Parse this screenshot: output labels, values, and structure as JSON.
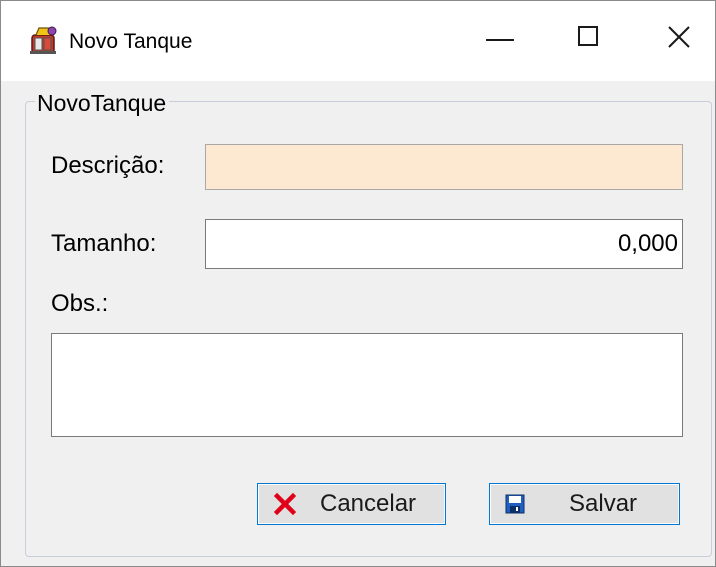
{
  "window": {
    "title": "Novo Tanque",
    "app_icon": "tank-app-icon",
    "controls": {
      "minimize_icon": "minimize-icon",
      "maximize_icon": "maximize-icon",
      "close_icon": "close-icon"
    }
  },
  "form": {
    "group_title": "NovoTanque",
    "descricao": {
      "label": "Descrição:",
      "value": "",
      "background": "#fde8d2"
    },
    "tamanho": {
      "label": "Tamanho:",
      "value": "0,000"
    },
    "obs": {
      "label": "Obs.:",
      "value": ""
    }
  },
  "buttons": {
    "cancel": {
      "label": "Cancelar",
      "icon": "red-x-icon",
      "icon_color": "#e0001a"
    },
    "save": {
      "label": "Salvar",
      "icon": "floppy-disk-icon",
      "icon_color": "#1f5fbf"
    }
  },
  "colors": {
    "accent_border": "#0078d7",
    "window_background": "#f0f0f0"
  }
}
